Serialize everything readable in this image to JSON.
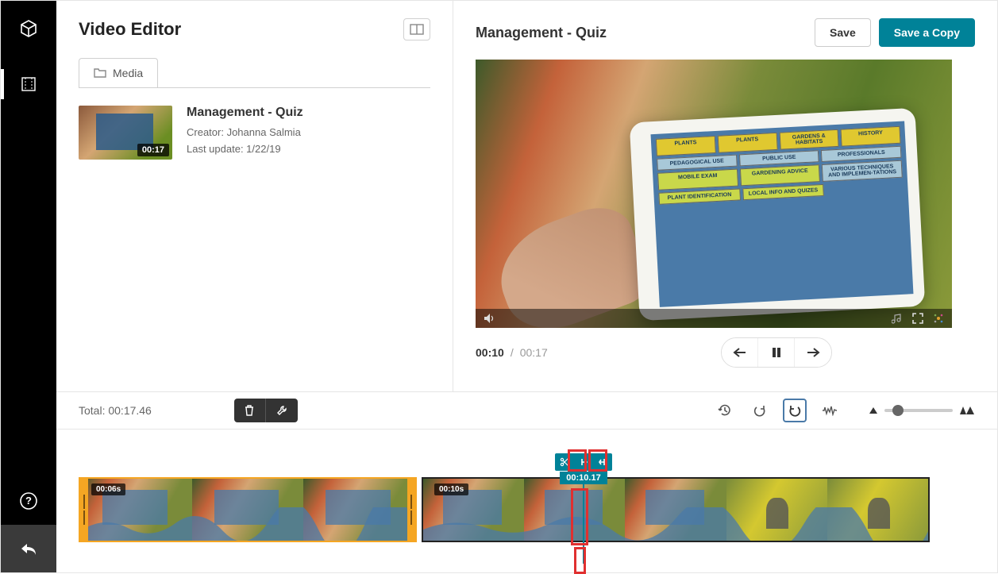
{
  "app": {
    "title": "Video Editor"
  },
  "tabs": {
    "media": "Media"
  },
  "media_item": {
    "title": "Management - Quiz",
    "creator_label": "Creator: Johanna Salmia",
    "last_update_label": "Last update: 1/22/19",
    "thumb_duration": "00:17"
  },
  "preview": {
    "title": "Management - Quiz",
    "save": "Save",
    "save_copy": "Save a Copy",
    "time_current": "00:10",
    "time_sep": "/",
    "time_total": "00:17",
    "tablet": {
      "row1": [
        "PLANTS",
        "PLANTS",
        "GARDENS & HABITATS",
        "HISTORY"
      ],
      "row2": [
        "PEDAGOGICAL USE",
        "PUBLIC USE",
        "PROFESSIONALS"
      ],
      "row3": [
        "MOBILE EXAM",
        "GARDENING ADVICE",
        "VARIOUS TECHNIQUES AND IMPLEMEN-TATIONS"
      ],
      "row4": [
        "PLANT IDENTIFICATION",
        "LOCAL INFO AND QUIZES"
      ]
    }
  },
  "toolbar": {
    "total_label": "Total: 00:17.46"
  },
  "timeline": {
    "clip1_label": "00:06s",
    "clip2_label": "00:10s",
    "playhead_time": "00:10.17"
  }
}
